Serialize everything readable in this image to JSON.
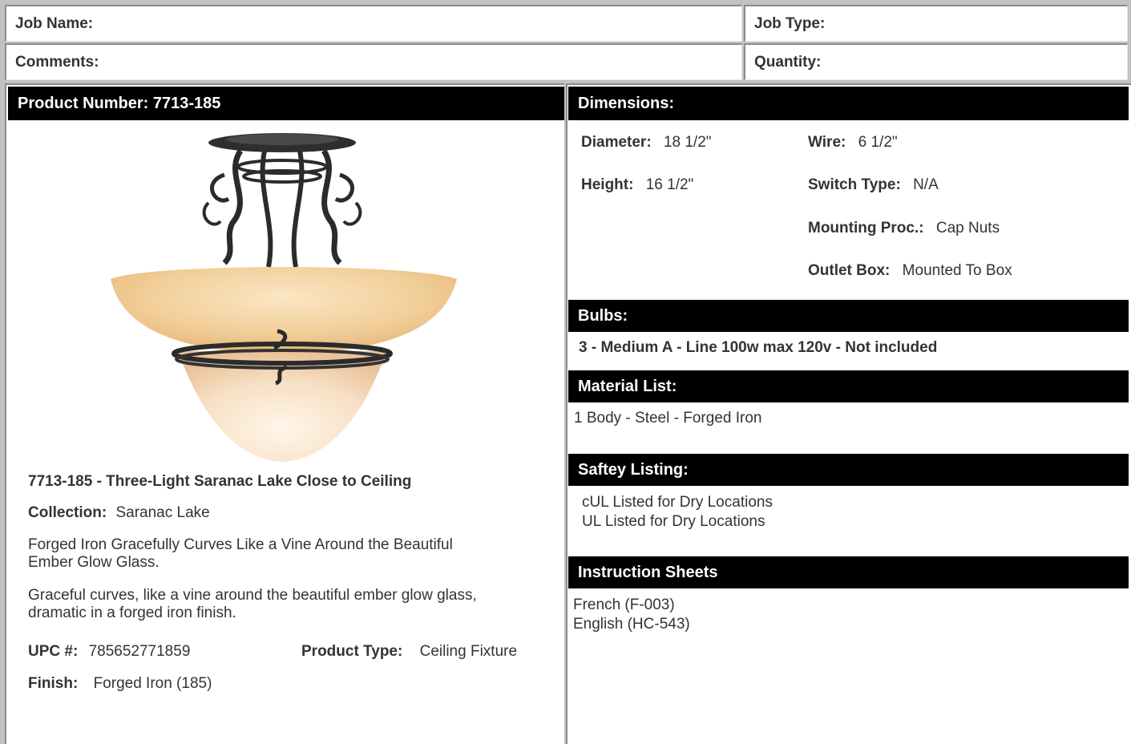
{
  "header": {
    "job_name_label": "Job Name:",
    "job_type_label": "Job Type:",
    "comments_label": "Comments:",
    "quantity_label": "Quantity:"
  },
  "product": {
    "number_bar": "Product Number: 7713-185",
    "image_icon": "ceiling-fixture-image",
    "title": "7713-185 - Three-Light Saranac Lake Close to Ceiling",
    "collection_label": "Collection:",
    "collection_value": "Saranac Lake",
    "tagline_line1": "Forged Iron Gracefully Curves Like a Vine Around the Beautiful",
    "tagline_line2": "Ember Glow Glass.",
    "description_line1": "Graceful curves, like a vine around the beautiful ember glow glass,",
    "description_line2": "dramatic in a forged iron finish.",
    "upc_label": "UPC #:",
    "upc_value": "785652771859",
    "type_label": "Product Type:",
    "type_value": "Ceiling Fixture",
    "finish_label": "Finish:",
    "finish_value": "Forged Iron (185)"
  },
  "dimensions": {
    "bar": "Dimensions:",
    "diameter_label": "Diameter:",
    "diameter_value": "18 1/2\"",
    "height_label": "Height:",
    "height_value": "16 1/2\"",
    "wire_label": "Wire:",
    "wire_value": "6 1/2\"",
    "switch_label": "Switch Type:",
    "switch_value": "N/A",
    "mounting_label": "Mounting Proc.:",
    "mounting_value": "Cap Nuts",
    "outlet_label": "Outlet Box:",
    "outlet_value": "Mounted To Box"
  },
  "bulbs": {
    "bar": "Bulbs:",
    "text": "3 - Medium A - Line 100w max 120v - Not included"
  },
  "materials": {
    "bar": "Material List:",
    "text": "1 Body - Steel - Forged Iron"
  },
  "safety": {
    "bar": "Saftey Listing:",
    "line1": "cUL Listed for Dry Locations",
    "line2": "UL Listed for Dry Locations"
  },
  "instructions": {
    "bar": "Instruction Sheets",
    "items": [
      "French (F-003)",
      "English (HC-543)"
    ]
  },
  "colors": {
    "bar_bg": "#000000",
    "bar_text": "#ffffff",
    "body_text": "#333333",
    "border": "#8c8c8c",
    "glass": "#f1cf9e",
    "iron": "#2b2b2b"
  }
}
